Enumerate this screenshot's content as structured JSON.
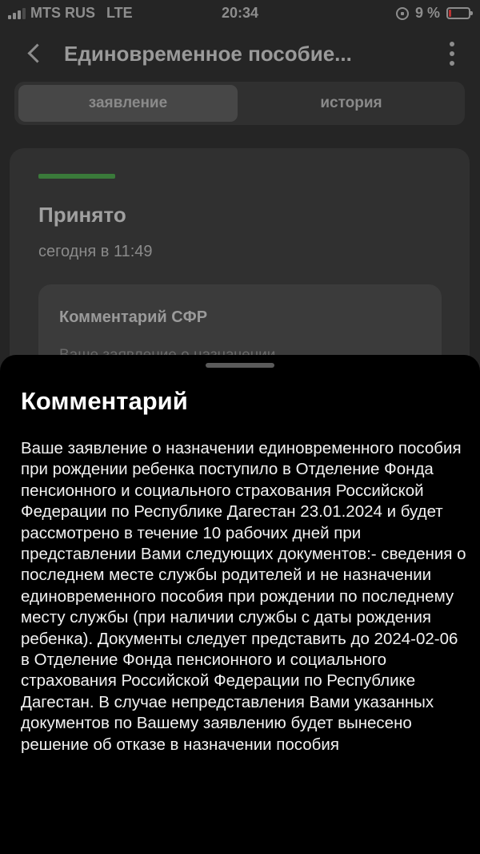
{
  "status_bar": {
    "carrier": "MTS RUS",
    "network": "LTE",
    "time": "20:34",
    "battery": "9 %"
  },
  "header": {
    "title": "Единовременное пособие..."
  },
  "tabs": [
    {
      "label": "заявление",
      "active": true
    },
    {
      "label": "история",
      "active": false
    }
  ],
  "status_card": {
    "status": "Принято",
    "date": "сегодня в 11:49",
    "accent": "#3a7a3a",
    "comment_title": "Комментарий СФР",
    "comment_peek": "Ваше заявление о назначении"
  },
  "sheet": {
    "title": "Комментарий",
    "body": "Ваше заявление о назначении единовременного пособия при рождении ребенка поступило в Отделение Фонда пенсионного и социального страхования Российской Федерации по Республике Дагестан 23.01.2024 и будет рассмотрено в течение 10 рабочих дней при представлении Вами следующих документов:- сведения о последнем месте службы родителей и не назначении единовременного пособия при рождении по последнему месту службы (при наличии службы с даты рождения ребенка). Документы следует представить до 2024-02-06 в Отделение Фонда пенсионного и социального страхования Российской Федерации по Республике Дагестан. В случае непредставления Вами указанных документов по Вашему заявлению будет вынесено решение об отказе в назначении пособия"
  }
}
